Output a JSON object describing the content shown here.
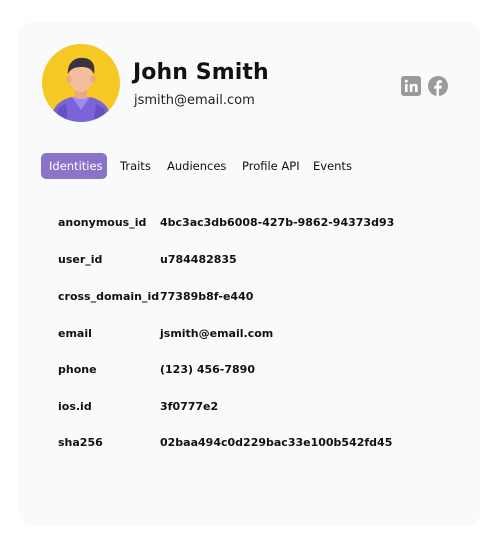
{
  "profile": {
    "name": "John Smith",
    "email": "jsmith@email.com",
    "avatar_icon": "person-avatar-icon",
    "avatar_bg": "#f6c824",
    "social": [
      {
        "icon": "linkedin-icon",
        "label": "in"
      },
      {
        "icon": "facebook-icon",
        "label": "f"
      }
    ]
  },
  "tabs": [
    {
      "label": "Identities",
      "active": true
    },
    {
      "label": "Traits",
      "active": false
    },
    {
      "label": "Audiences",
      "active": false
    },
    {
      "label": "Profile API",
      "active": false
    },
    {
      "label": "Events",
      "active": false
    }
  ],
  "accent_color": "#8a73c9",
  "identities": [
    {
      "key": "anonymous_id",
      "value": "4bc3ac3db6008-427b-9862-94373d93"
    },
    {
      "key": "user_id",
      "value": "u784482835"
    },
    {
      "key": "cross_domain_id",
      "value": "77389b8f-e440"
    },
    {
      "key": "email",
      "value": "jsmith@email.com"
    },
    {
      "key": "phone",
      "value": "(123) 456-7890"
    },
    {
      "key": "ios.id",
      "value": "3f0777e2"
    },
    {
      "key": "sha256",
      "value": "02baa494c0d229bac33e100b542fd45"
    }
  ]
}
